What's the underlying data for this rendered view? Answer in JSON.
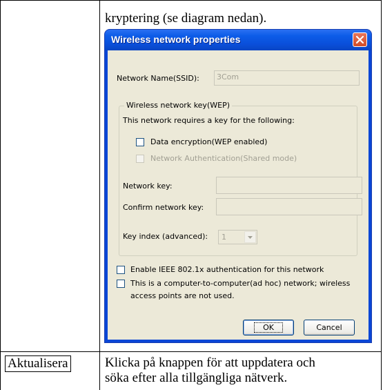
{
  "document": {
    "intro_text": "kryptering (se diagram nedan).",
    "row2_term": "Aktualisera",
    "row2_desc_line1": "Klicka på knappen för att uppdatera och",
    "row2_desc_line2": "söka efter alla tillgängliga nätverk."
  },
  "dialog": {
    "title": "Wireless network properties",
    "ssid_label": "Network Name(SSID):",
    "ssid_value": "3Com",
    "group_label": "Wireless network key(WEP)",
    "requires_key_text": "This network requires a key for the following:",
    "data_encryption_label": "Data encryption(WEP enabled)",
    "data_encryption_checked": false,
    "network_auth_label": "Network Authentication(Shared mode)",
    "network_auth_checked": false,
    "network_key_label": "Network key:",
    "network_key_value": "",
    "confirm_key_label": "Confirm network key:",
    "confirm_key_value": "",
    "key_index_label": "Key index (advanced):",
    "key_index_value": "1",
    "ieee_label": "Enable IEEE 802.1x authentication for this network",
    "ieee_checked": false,
    "adhoc_label_line1": "This is a computer-to-computer(ad hoc) network; wireless",
    "adhoc_label_line2": "access points are not used.",
    "adhoc_checked": false,
    "ok_label": "OK",
    "cancel_label": "Cancel"
  },
  "colors": {
    "titlebar": "#0a4fda",
    "client_bg": "#ece9d8",
    "close_button": "#d24c27",
    "disabled_text": "#a19f93"
  },
  "icons": {
    "close": "close-icon",
    "dropdown": "chevron-down-icon"
  }
}
